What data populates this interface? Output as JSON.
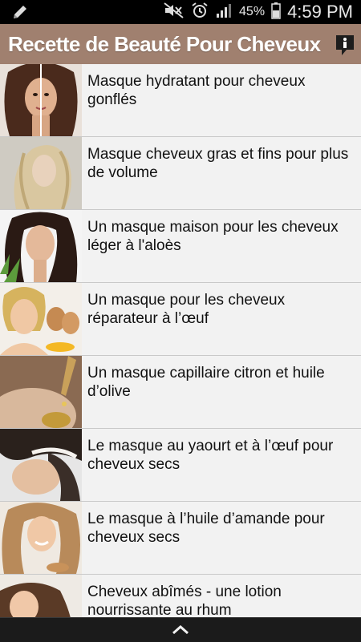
{
  "status_bar": {
    "battery_percent": "45%",
    "time": "4:59 PM",
    "icons": [
      "pencil-icon",
      "mute-icon",
      "alarm-icon",
      "signal-icon",
      "battery-icon"
    ]
  },
  "app_bar": {
    "title": "Recette de Beauté Pour Cheveux",
    "background": "#a0806f",
    "info_icon": "info-icon"
  },
  "list": {
    "items": [
      {
        "title": "Masque hydratant pour cheveux gonflés"
      },
      {
        "title": "Masque cheveux gras et fins pour plus de volume"
      },
      {
        "title": "Un masque maison pour les cheveux léger à l'aloès"
      },
      {
        "title": "Un masque pour les cheveux réparateur à l’œuf"
      },
      {
        "title": "Un masque capillaire citron et huile d’olive"
      },
      {
        "title": "Le masque au yaourt et à l’œuf pour cheveux secs"
      },
      {
        "title": "Le masque à l’huile d’amande  pour cheveux secs"
      },
      {
        "title": "Cheveux abîmés - une lotion nourrissante au rhum"
      }
    ]
  },
  "bottom_bar": {
    "icon": "chevron-up-icon"
  }
}
